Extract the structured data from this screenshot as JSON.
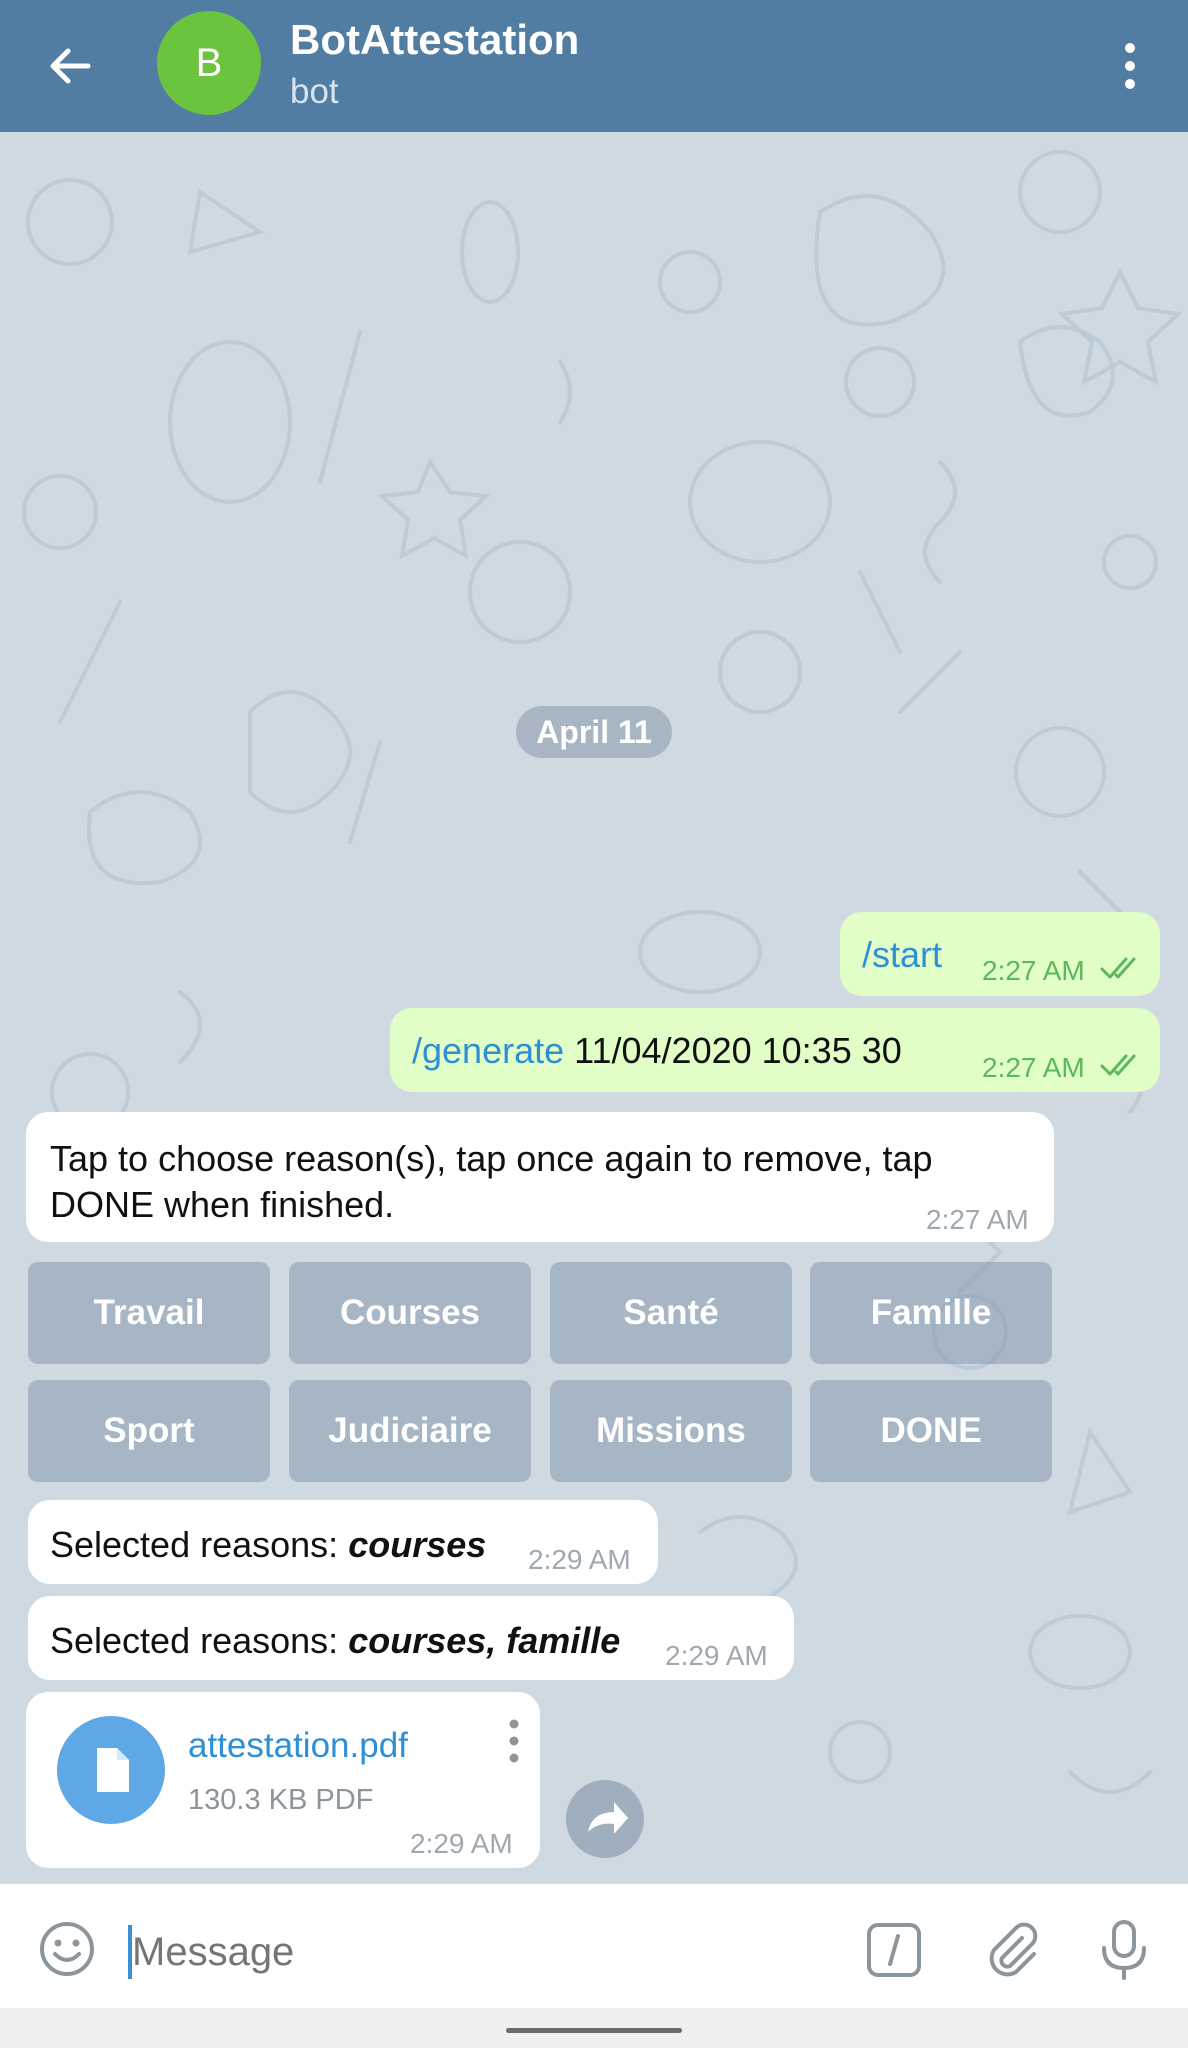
{
  "header": {
    "avatar_letter": "B",
    "title": "BotAttestation",
    "subtitle": "bot",
    "avatar_color": "#6cc43e",
    "bar_color": "#517da2"
  },
  "chat": {
    "date_divider": "April 11",
    "messages": [
      {
        "direction": "out",
        "command": "/start",
        "text": "",
        "time": "2:27 AM",
        "status": "read"
      },
      {
        "direction": "out",
        "command": "/generate",
        "text": " 11/04/2020 10:35 30",
        "time": "2:27 AM",
        "status": "read"
      },
      {
        "direction": "in",
        "line1": "Tap to choose reason(s), tap once again to remove, tap",
        "line2": "DONE when finished.",
        "time": "2:27 AM"
      },
      {
        "direction": "in",
        "prefix": "Selected reasons: ",
        "value": "courses",
        "time": "2:29 AM"
      },
      {
        "direction": "in",
        "prefix": "Selected reasons: ",
        "value": "courses, famille",
        "time": "2:29 AM"
      }
    ],
    "keyboard": {
      "row1": [
        "Travail",
        "Courses",
        "Santé",
        "Famille"
      ],
      "row2": [
        "Sport",
        "Judiciaire",
        "Missions",
        "DONE"
      ]
    },
    "document": {
      "file_name": "attestation.pdf",
      "file_info": "130.3 KB PDF",
      "time": "2:29 AM",
      "icon": "file-icon"
    }
  },
  "input_bar": {
    "placeholder": "Message"
  },
  "colors": {
    "outgoing_bubble": "#e1fec6",
    "incoming_bubble": "#ffffff",
    "command_link": "#2f8fd6",
    "read_ticks": "#5cb85c"
  }
}
